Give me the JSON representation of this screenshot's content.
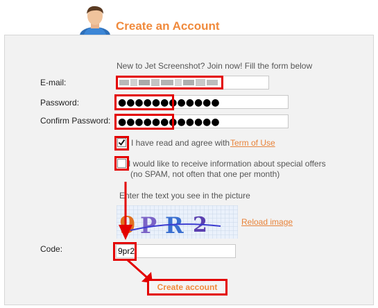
{
  "header": {
    "title": "Create an Account"
  },
  "form": {
    "intro": "New to Jet Screenshot? Join now! Fill the form below",
    "email_label": "E-mail:",
    "password_label": "Password:",
    "password_mask": "●●●●●●●●●●●●",
    "confirm_label": "Confirm Password:",
    "confirm_mask": "●●●●●●●●●●●●",
    "agree_text": "I have read and agree with",
    "terms_link": "Term of Use",
    "agree_checked": true,
    "offers_line1": "I would like to receive information about special offers",
    "offers_line2": "(no SPAM, not often that one per month)",
    "offers_checked": false,
    "captcha_prompt": "Enter the text you see in the picture",
    "captcha_text": "9PR2",
    "reload_link": "Reload image",
    "code_label": "Code:",
    "code_value": "9pr2",
    "submit_label": "Create account"
  },
  "colors": {
    "accent": "#f08a3c",
    "annotation": "#e30000"
  }
}
